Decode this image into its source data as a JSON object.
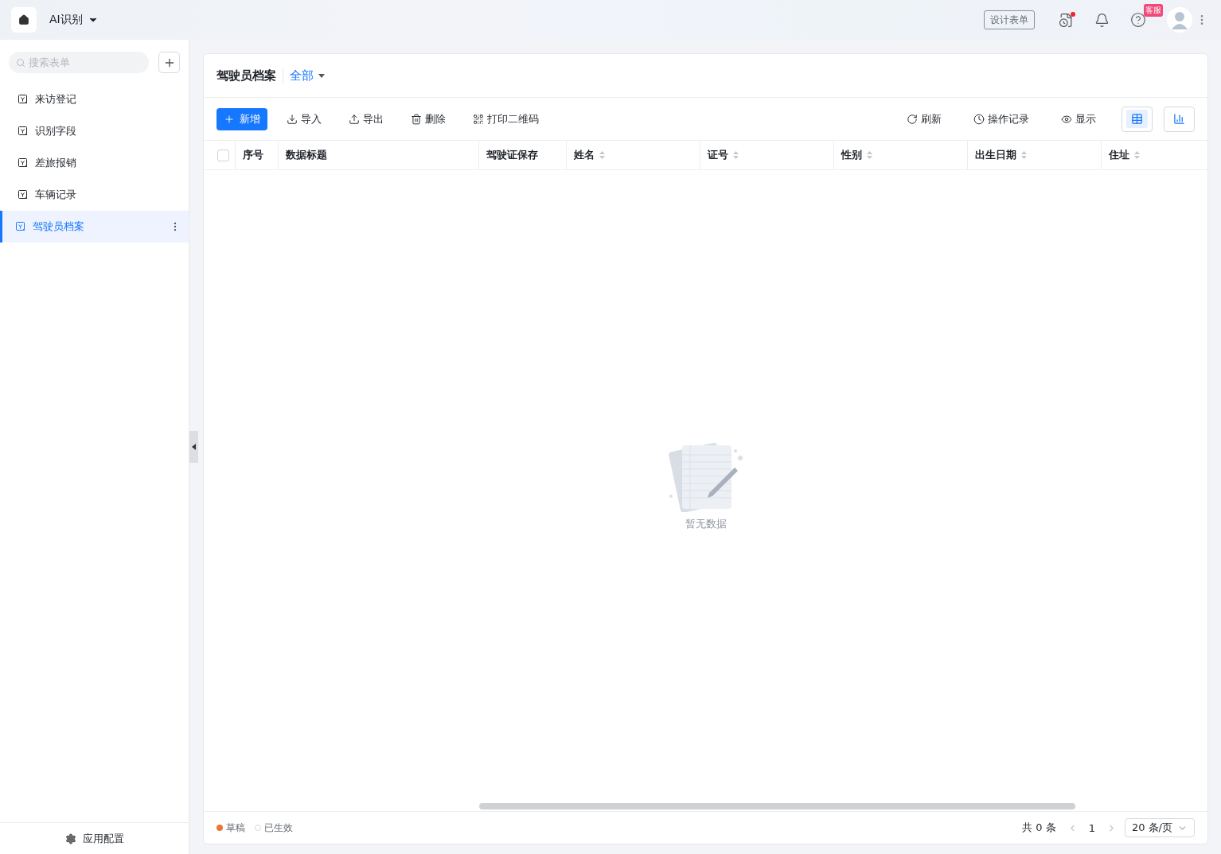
{
  "topbar": {
    "app_name": "AI识别",
    "design_button": "设计表单",
    "record_has_alert": true,
    "help_badge": "客服"
  },
  "sidebar": {
    "search": {
      "placeholder": "搜索表单"
    },
    "items": [
      {
        "label": "来访登记",
        "selected": false
      },
      {
        "label": "识别字段",
        "selected": false
      },
      {
        "label": "差旅报销",
        "selected": false
      },
      {
        "label": "车辆记录",
        "selected": false
      },
      {
        "label": "驾驶员档案",
        "selected": true
      }
    ],
    "footer": "应用配置"
  },
  "main": {
    "title": "驾驶员档案",
    "view": "全部",
    "toolbar_left": [
      {
        "kind": "add",
        "label": "新增"
      },
      {
        "kind": "import",
        "label": "导入"
      },
      {
        "kind": "export",
        "label": "导出"
      },
      {
        "kind": "delete",
        "label": "删除"
      },
      {
        "kind": "qrcode",
        "label": "打印二维码"
      }
    ],
    "toolbar_right": [
      {
        "kind": "refresh",
        "label": "刷新"
      },
      {
        "kind": "history",
        "label": "操作记录"
      },
      {
        "kind": "display",
        "label": "显示"
      }
    ],
    "view_toggles": [
      {
        "kind": "table",
        "selected": true
      },
      {
        "kind": "chart",
        "selected": false
      }
    ],
    "table": {
      "all_checked": false,
      "columns": [
        {
          "label": "序号",
          "sortable": false
        },
        {
          "label": "数据标题",
          "sortable": false
        },
        {
          "label": "驾驶证保存",
          "sortable": false
        },
        {
          "label": "姓名",
          "sortable": true
        },
        {
          "label": "证号",
          "sortable": true
        },
        {
          "label": "性别",
          "sortable": true
        },
        {
          "label": "出生日期",
          "sortable": true
        },
        {
          "label": "住址",
          "sortable": true
        }
      ],
      "empty_text": "暂无数据"
    },
    "legend": [
      {
        "label": "草稿",
        "color": "#e8783a",
        "kind": "filled"
      },
      {
        "label": "已生效",
        "color": "#d9d9d9",
        "kind": "hollow"
      }
    ],
    "pagination": {
      "total": "共 0 条",
      "page": "1",
      "page_size": "20 条/页"
    }
  }
}
